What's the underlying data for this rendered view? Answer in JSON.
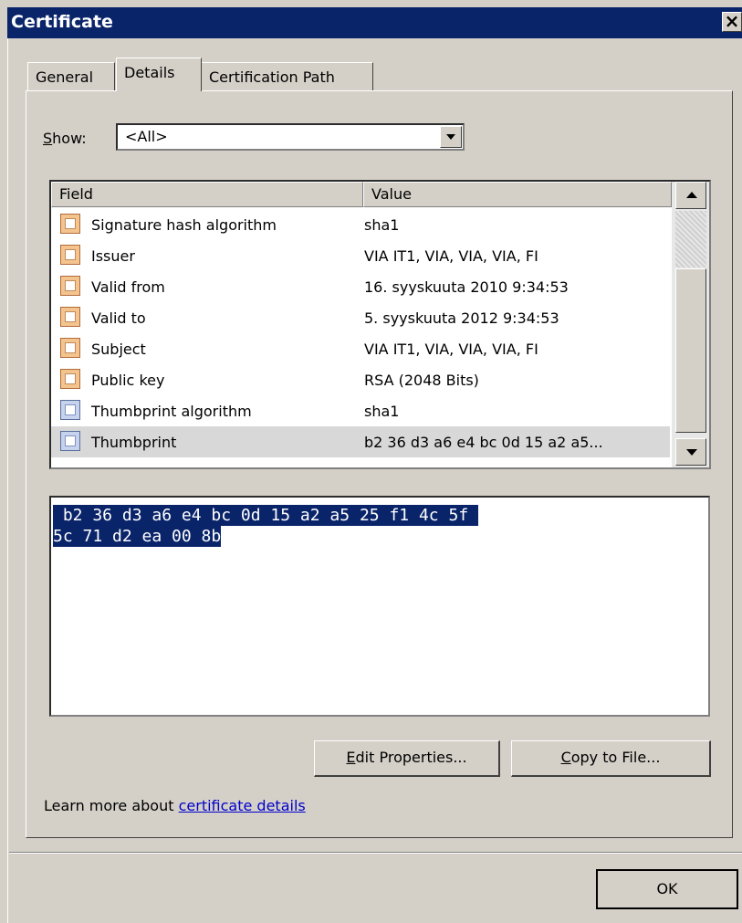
{
  "window": {
    "title": "Certificate",
    "close_glyph": "×"
  },
  "tabs": [
    {
      "label": "General"
    },
    {
      "label": "Details"
    },
    {
      "label": "Certification Path"
    }
  ],
  "show": {
    "label_accel": "S",
    "label_rest": "how:",
    "selected": "<All>"
  },
  "list": {
    "columns": {
      "field": "Field",
      "value": "Value"
    },
    "rows": [
      {
        "field": "Signature hash algorithm",
        "value": "sha1",
        "icon": "certificate-field-icon"
      },
      {
        "field": "Issuer",
        "value": "VIA IT1, VIA, VIA, VIA, FI",
        "icon": "certificate-field-icon"
      },
      {
        "field": "Valid from",
        "value": "16. syyskuuta 2010 9:34:53",
        "icon": "certificate-field-icon"
      },
      {
        "field": "Valid to",
        "value": "5. syyskuuta 2012 9:34:53",
        "icon": "certificate-field-icon"
      },
      {
        "field": "Subject",
        "value": "VIA IT1, VIA, VIA, VIA, FI",
        "icon": "certificate-field-icon"
      },
      {
        "field": "Public key",
        "value": "RSA (2048 Bits)",
        "icon": "certificate-field-icon"
      },
      {
        "field": "Thumbprint algorithm",
        "value": "sha1",
        "icon": "certificate-property-icon"
      },
      {
        "field": "Thumbprint",
        "value": "b2 36 d3 a6 e4 bc 0d 15 a2 a5...",
        "icon": "certificate-property-icon"
      }
    ],
    "selected_index": 7
  },
  "value_box": {
    "line1": " b2 36 d3 a6 e4 bc 0d 15 a2 a5 25 f1 4c 5f ",
    "line2": "5c 71 d2 ea 00 8b"
  },
  "buttons": {
    "edit_accel": "E",
    "edit_rest": "dit Properties...",
    "copy_accel": "C",
    "copy_rest": "opy to File...",
    "ok": "OK"
  },
  "learn_more": {
    "prefix": "Learn more about ",
    "link": "certificate details"
  },
  "colors": {
    "titlebar": "#0a246a",
    "dialog_bg": "#d4d0c8",
    "selection": "#0a246a",
    "link": "#0000cc"
  }
}
